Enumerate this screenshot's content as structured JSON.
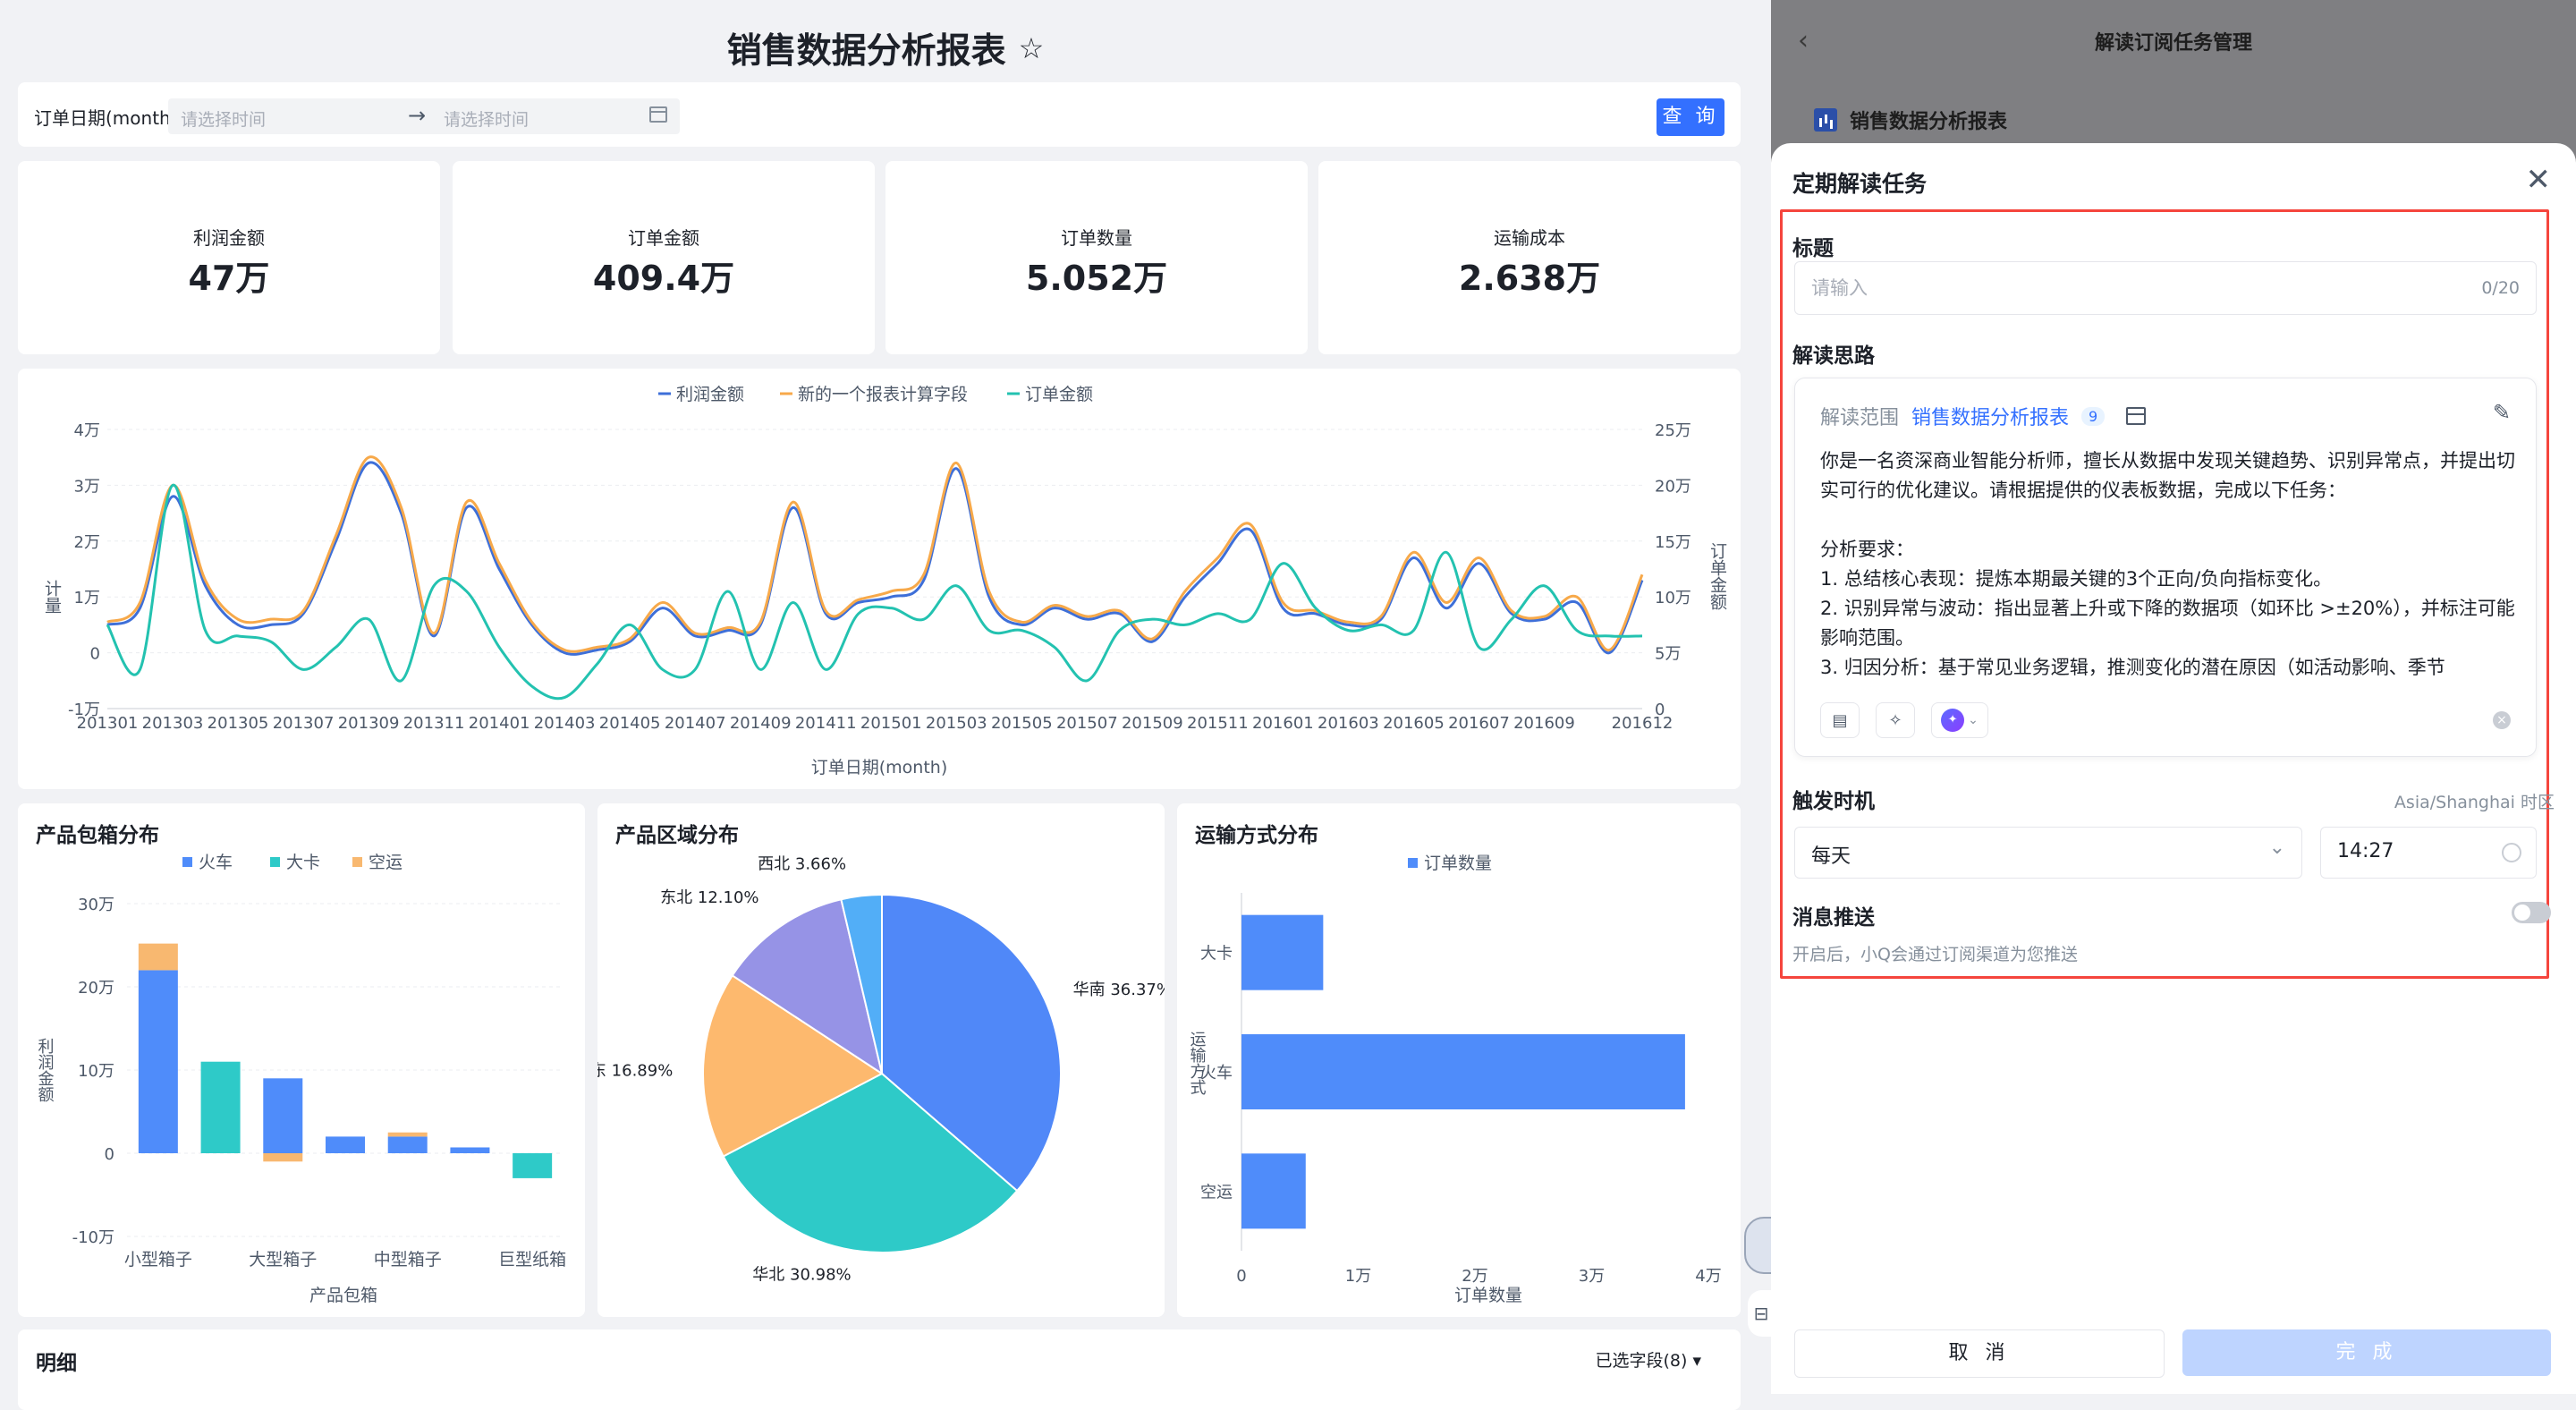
{
  "page_title": "销售数据分析报表",
  "filter": {
    "label": "订单日期(month)",
    "start_placeholder": "请选择时间",
    "end_placeholder": "请选择时间",
    "arrow": "→",
    "query_button": "查 询"
  },
  "kpis": [
    {
      "label": "利润金额",
      "value": "47万"
    },
    {
      "label": "订单金额",
      "value": "409.4万"
    },
    {
      "label": "订单数量",
      "value": "5.052万"
    },
    {
      "label": "运输成本",
      "value": "2.638万"
    }
  ],
  "line_chart": {
    "legend": [
      "利润金额",
      "新的一个报表计算字段",
      "订单金额"
    ],
    "colors": [
      "#3e6fd8",
      "#f7a94a",
      "#23c2b0"
    ],
    "left_axis_label": "计量",
    "right_axis_label": "订单金额",
    "x_label": "订单日期(month)",
    "left_ticks": [
      "4万",
      "3万",
      "2万",
      "1万",
      "0",
      "-1万"
    ],
    "right_ticks": [
      "25万",
      "20万",
      "15万",
      "10万",
      "5万",
      "0"
    ],
    "x_ticks": [
      "201301",
      "201303",
      "201305",
      "201307",
      "201309",
      "201311",
      "201401",
      "201403",
      "201405",
      "201407",
      "201409",
      "201411",
      "201501",
      "201503",
      "201505",
      "201507",
      "201509",
      "201511",
      "201601",
      "201603",
      "201605",
      "201607",
      "201609",
      "201612"
    ]
  },
  "chart_data": [
    {
      "type": "line",
      "title": "",
      "x_label": "订单日期(month)",
      "y_label": "计量",
      "y2_label": "订单金额",
      "ylim": [
        -10000,
        40000
      ],
      "y2lim": [
        0,
        250000
      ],
      "x": [
        "201301",
        "201302",
        "201303",
        "201304",
        "201305",
        "201306",
        "201307",
        "201308",
        "201309",
        "201310",
        "201311",
        "201312",
        "201401",
        "201402",
        "201403",
        "201404",
        "201405",
        "201406",
        "201407",
        "201408",
        "201409",
        "201410",
        "201411",
        "201412",
        "201501",
        "201502",
        "201503",
        "201504",
        "201505",
        "201506",
        "201507",
        "201508",
        "201509",
        "201510",
        "201511",
        "201512",
        "201601",
        "201602",
        "201603",
        "201604",
        "201605",
        "201606",
        "201607",
        "201608",
        "201609",
        "201610",
        "201611",
        "201612"
      ],
      "series": [
        {
          "name": "利润金额",
          "axis": "left",
          "values": [
            5000,
            8000,
            28000,
            12000,
            5000,
            5000,
            7000,
            20000,
            34000,
            25000,
            3000,
            26000,
            15000,
            5000,
            0,
            500,
            2000,
            8000,
            3000,
            4000,
            5000,
            26000,
            7000,
            9000,
            10000,
            13000,
            33000,
            10000,
            5000,
            8000,
            6000,
            7000,
            2000,
            10000,
            16000,
            22000,
            8000,
            7000,
            5000,
            6000,
            17000,
            8000,
            16000,
            7000,
            6000,
            9000,
            0,
            13000
          ]
        },
        {
          "name": "新的一个报表计算字段",
          "axis": "left",
          "values": [
            5500,
            9000,
            30000,
            13000,
            6000,
            6000,
            7500,
            21000,
            35000,
            26000,
            3500,
            27000,
            16000,
            5500,
            500,
            1000,
            2500,
            9000,
            3500,
            4500,
            5500,
            27000,
            7500,
            9500,
            11000,
            14000,
            34000,
            11000,
            5500,
            8500,
            6500,
            7500,
            2500,
            11000,
            17000,
            23000,
            9000,
            7500,
            5500,
            6500,
            18000,
            9000,
            17000,
            7500,
            6500,
            10000,
            500,
            14000
          ]
        },
        {
          "name": "订单金额",
          "axis": "right",
          "values": [
            75000,
            35000,
            200000,
            70000,
            65000,
            60000,
            35000,
            55000,
            80000,
            25000,
            110000,
            105000,
            55000,
            20000,
            10000,
            40000,
            75000,
            35000,
            35000,
            105000,
            35000,
            95000,
            35000,
            85000,
            90000,
            80000,
            110000,
            70000,
            70000,
            55000,
            25000,
            70000,
            80000,
            75000,
            85000,
            80000,
            130000,
            90000,
            70000,
            75000,
            70000,
            140000,
            55000,
            80000,
            110000,
            70000,
            65000,
            65000
          ]
        }
      ]
    },
    {
      "type": "bar",
      "title": "产品包箱分布",
      "stacked": true,
      "x_label": "产品包箱",
      "y_label": "利润金额",
      "ylim": [
        -100000,
        300000
      ],
      "categories": [
        "小型箱子",
        "",
        "大型箱子",
        "",
        "中型箱子",
        "",
        "巨型纸箱"
      ],
      "series": [
        {
          "name": "火车",
          "color": "#4f8cfa",
          "values": [
            220000,
            0,
            90000,
            20000,
            20000,
            7000,
            0
          ]
        },
        {
          "name": "大卡",
          "color": "#2ecac8",
          "values": [
            0,
            110000,
            0,
            0,
            0,
            0,
            -30000
          ]
        },
        {
          "name": "空运",
          "color": "#f8b870",
          "values": [
            32000,
            0,
            -10000,
            0,
            5000,
            0,
            0
          ]
        }
      ]
    },
    {
      "type": "pie",
      "title": "产品区域分布",
      "labels": [
        "华南",
        "华北",
        "华东",
        "东北",
        "西北"
      ],
      "values": [
        36.37,
        30.98,
        16.89,
        12.1,
        3.66
      ],
      "colors": [
        "#5088f8",
        "#2ecac8",
        "#fdb96e",
        "#9693e6",
        "#52aef7"
      ]
    },
    {
      "type": "bar",
      "orientation": "horizontal",
      "title": "运输方式分布",
      "x_label": "订单数量",
      "y_label": "运输方式",
      "xlim": [
        0,
        40000
      ],
      "categories": [
        "大卡",
        "火车",
        "空运"
      ],
      "series": [
        {
          "name": "订单数量",
          "color": "#4f8cfa",
          "values": [
            7000,
            38000,
            5500
          ]
        }
      ]
    }
  ],
  "box_chart": {
    "title": "产品包箱分布",
    "legend": [
      "火车",
      "大卡",
      "空运"
    ],
    "y_ticks": [
      "30万",
      "20万",
      "10万",
      "0",
      "-10万"
    ],
    "y_label": "利润金额",
    "x_ticks": [
      "小型箱子",
      "大型箱子",
      "中型箱子",
      "巨型纸箱"
    ],
    "x_label": "产品包箱"
  },
  "region_chart": {
    "title": "产品区域分布",
    "labels": [
      "华南 36.37%",
      "华北 30.98%",
      "华东 16.89%",
      "东北 12.10%",
      "西北 3.66%"
    ]
  },
  "ship_chart": {
    "title": "运输方式分布",
    "legend": "订单数量",
    "y_ticks": [
      "大卡",
      "火车",
      "空运"
    ],
    "y_label": "运输方式",
    "x_ticks": [
      "0",
      "1万",
      "2万",
      "3万",
      "4万"
    ],
    "x_label": "订单数量"
  },
  "detail": {
    "title": "明细",
    "fields": "已选字段(8)"
  },
  "overlay": {
    "back": "‹",
    "title": "解读订阅任务管理",
    "report_name": "销售数据分析报表"
  },
  "dialog": {
    "title": "定期解读任务",
    "close": "✕",
    "title_label": "标题",
    "title_placeholder": "请输入",
    "title_count": "0/20",
    "think_label": "解读思路",
    "scope_label": "解读范围",
    "scope_link": "销售数据分析报表",
    "scope_count": "9",
    "prompt": "你是一名资深商业智能分析师，擅长从数据中发现关键趋势、识别异常点，并提出切实可行的优化建议。请根据提供的仪表板数据，完成以下任务：\n\n分析要求：\n1. 总结核心表现：提炼本期最关键的3个正向/负向指标变化。\n2. 识别异常与波动：指出显著上升或下降的数据项（如环比 >±20%），并标注可能影响范围。\n3. 归因分析：基于常见业务逻辑，推测变化的潜在原因（如活动影响、季节",
    "trigger_label": "触发时机",
    "timezone": "Asia/Shanghai 时区",
    "frequency": "每天",
    "time": "14:27",
    "push_label": "消息推送",
    "push_hint": "开启后，小Q会通过订阅渠道为您推送",
    "cancel": "取 消",
    "done": "完 成"
  }
}
